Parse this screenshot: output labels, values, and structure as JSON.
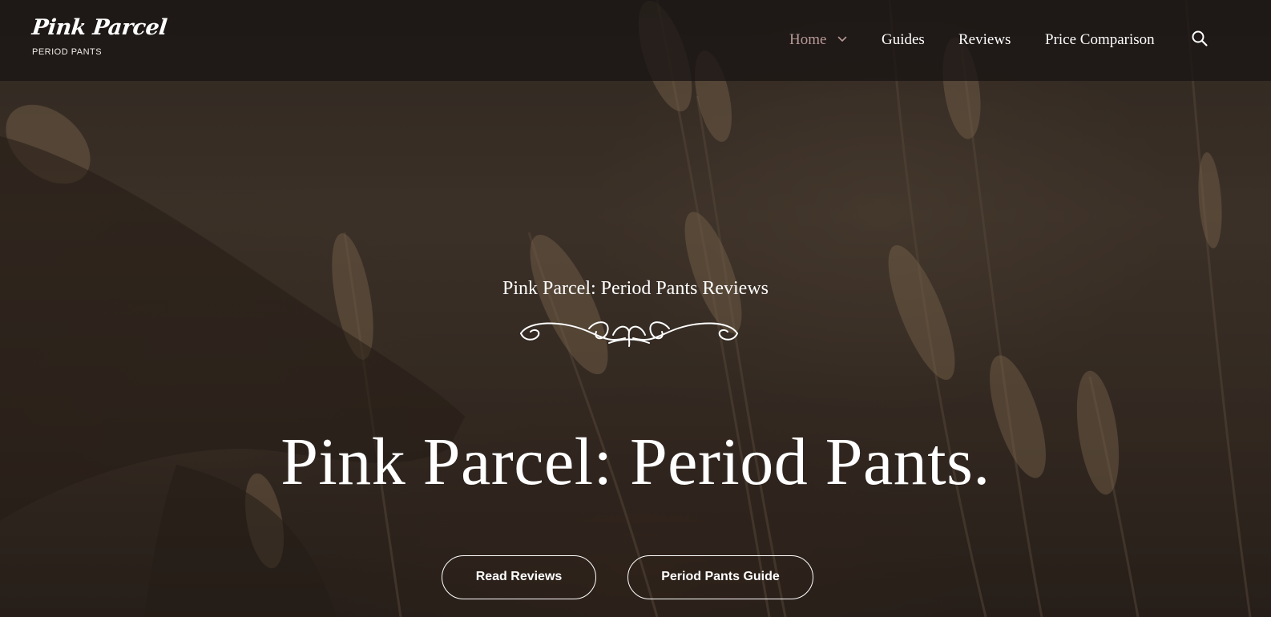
{
  "header": {
    "brand_title": "Pink Parcel",
    "brand_tagline": "PERIOD PANTS",
    "nav": {
      "home": "Home",
      "guides": "Guides",
      "reviews": "Reviews",
      "price_comparison": "Price Comparison"
    },
    "icons": {
      "home_dropdown": "chevron-down-icon",
      "search": "search-icon"
    },
    "active_nav_color": "#b89a96"
  },
  "hero": {
    "subtitle": "Pink Parcel: Period Pants Reviews",
    "title": "Pink Parcel: Period Pants.",
    "buttons": {
      "read_reviews": "Read Reviews",
      "period_pants_guide": "Period Pants Guide"
    },
    "decoration": "flourish-divider"
  }
}
